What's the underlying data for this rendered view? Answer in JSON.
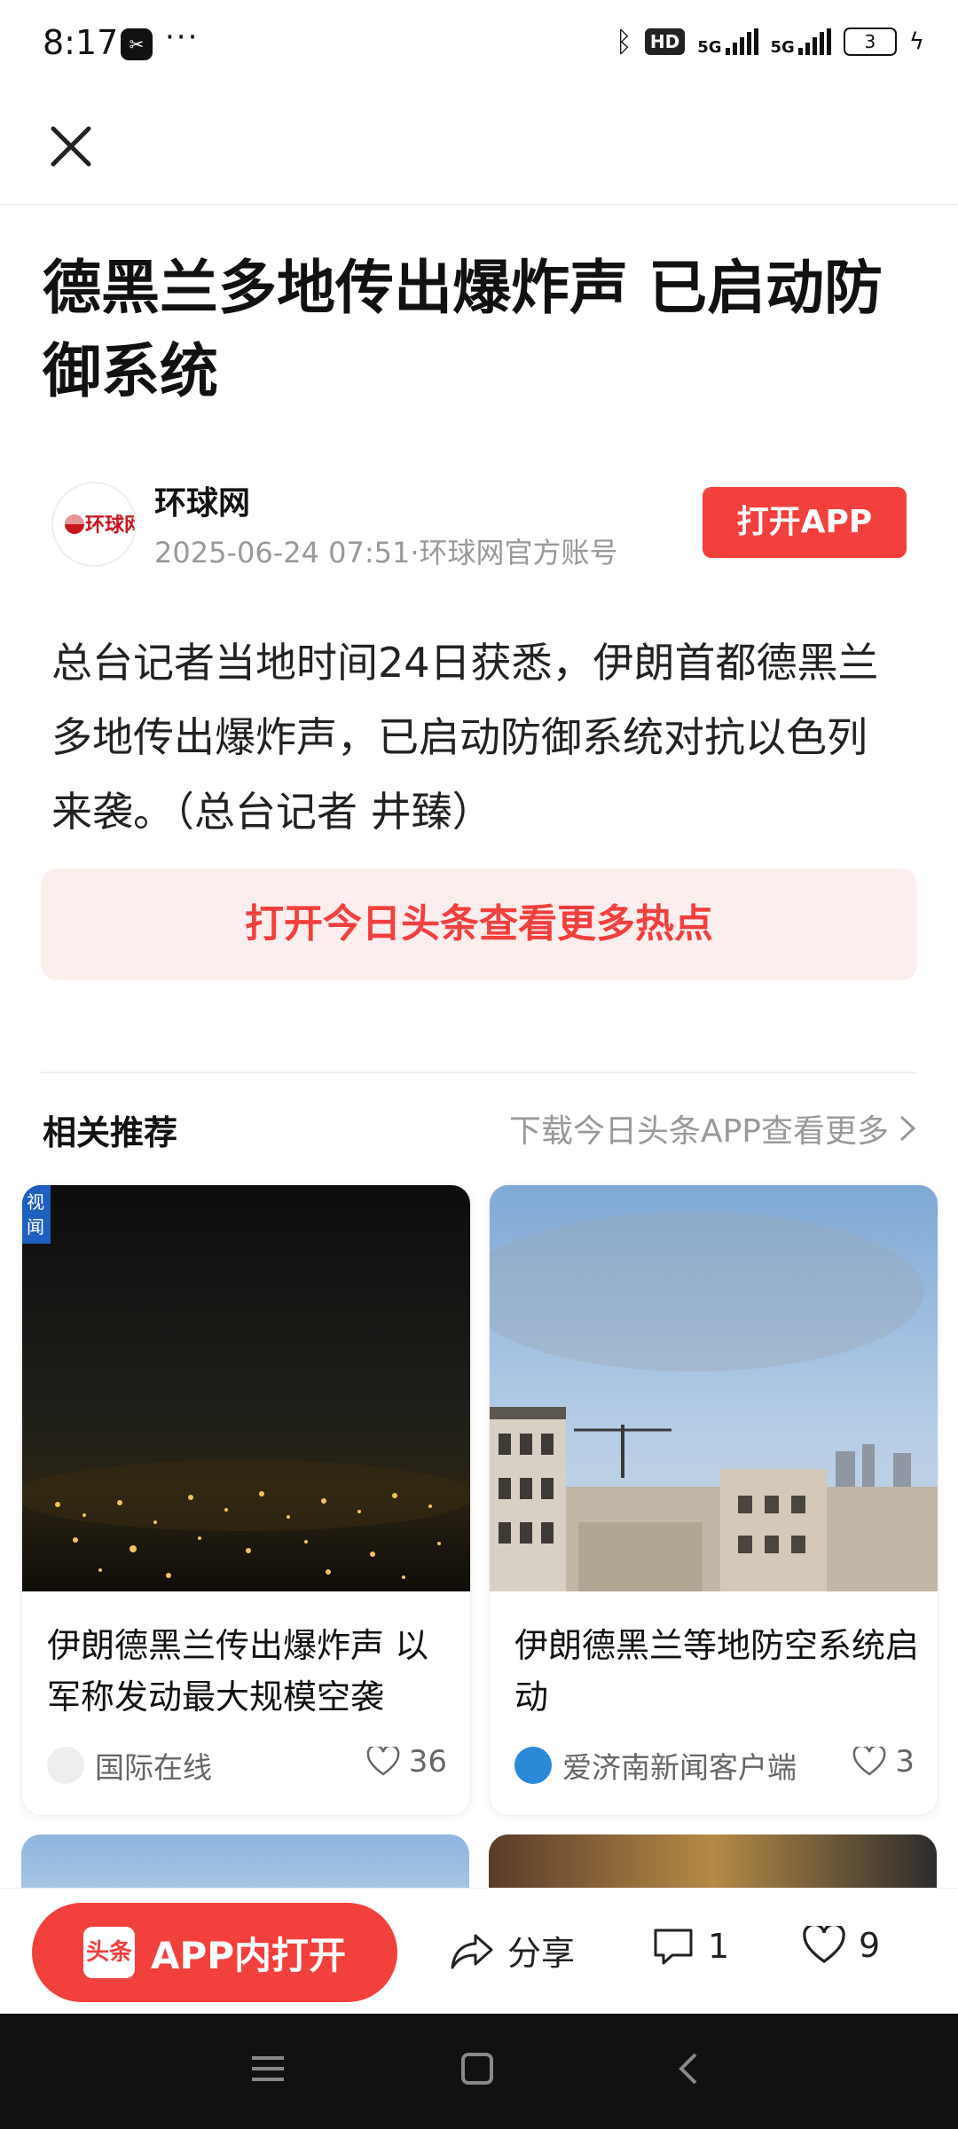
{
  "status_bar": {
    "time": "8:17",
    "app_icon": "capcut-icon",
    "more": "···",
    "hd_label": "HD",
    "network_1": "5G",
    "network_2": "5G",
    "battery": "3"
  },
  "article": {
    "title": "德黑兰多地传出爆炸声 已启动防御系统",
    "author": {
      "name": "环球网",
      "logo_text": "环球网",
      "meta": "2025-06-24 07:51·环球网官方账号"
    },
    "open_app_button": "打开APP",
    "body": "总台记者当地时间24日获悉，伊朗首都德黑兰多地传出爆炸声，已启动防御系统对抗以色列来袭。（总台记者 井臻）",
    "cta_banner": "打开今日头条查看更多热点"
  },
  "recommendations": {
    "heading": "相关推荐",
    "more_link": "下载今日头条APP查看更多",
    "cards": [
      {
        "title": "伊朗德黑兰传出爆炸声 以军称发动最大规模空袭",
        "badge": "视\n闻",
        "source": "国际在线",
        "likes": "36"
      },
      {
        "title": "伊朗德黑兰等地防空系统启动",
        "source": "爱济南新闻客户端",
        "likes": "3"
      }
    ]
  },
  "action_bar": {
    "open_in_app": "APP内打开",
    "toutiao_logo": "头条",
    "share": "分享",
    "comments": "1",
    "likes": "9"
  },
  "colors": {
    "accent": "#f2403d",
    "banner_bg": "#fdeeee"
  }
}
